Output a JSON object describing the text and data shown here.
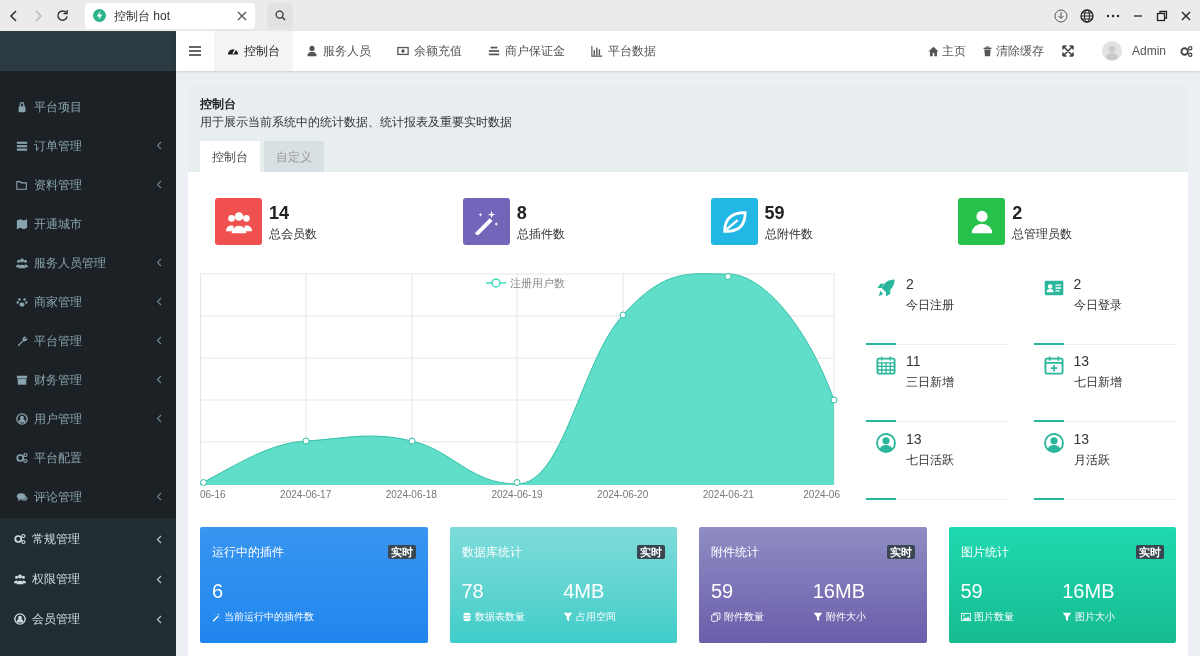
{
  "browser": {
    "tab_title": "控制台 hot"
  },
  "sidebar": {
    "items": [
      {
        "label": "平台项目",
        "kind": "plain"
      },
      {
        "label": "订单管理",
        "kind": "sub"
      },
      {
        "label": "资料管理",
        "kind": "sub"
      },
      {
        "label": "开通城市",
        "kind": "plain"
      },
      {
        "label": "服务人员管理",
        "kind": "sub"
      },
      {
        "label": "商家管理",
        "kind": "sub"
      },
      {
        "label": "平台管理",
        "kind": "sub"
      },
      {
        "label": "财务管理",
        "kind": "sub"
      },
      {
        "label": "用户管理",
        "kind": "sub"
      },
      {
        "label": "平台配置",
        "kind": "plain"
      },
      {
        "label": "评论管理",
        "kind": "sub"
      }
    ],
    "groups": [
      {
        "label": "常规管理"
      },
      {
        "label": "权限管理"
      },
      {
        "label": "会员管理"
      }
    ]
  },
  "topnav": {
    "tabs": [
      {
        "label": "控制台",
        "selected": true
      },
      {
        "label": "服务人员",
        "selected": false
      },
      {
        "label": "余额充值",
        "selected": false
      },
      {
        "label": "商户保证金",
        "selected": false
      },
      {
        "label": "平台数据",
        "selected": false
      }
    ],
    "right": [
      {
        "label": "主页"
      },
      {
        "label": "清除缓存"
      }
    ],
    "user": "Admin"
  },
  "panel": {
    "title": "控制台",
    "subtitle": "用于展示当前系统中的统计数据、统计报表及重要实时数据",
    "tabs": [
      {
        "label": "控制台",
        "selected": true
      },
      {
        "label": "自定义",
        "selected": false
      }
    ]
  },
  "summary": [
    {
      "value": "14",
      "label": "总会员数",
      "color": "#f05050"
    },
    {
      "value": "8",
      "label": "总插件数",
      "color": "#7266ba"
    },
    {
      "value": "59",
      "label": "总附件数",
      "color": "#23b7e5"
    },
    {
      "value": "2",
      "label": "总管理员数",
      "color": "#27c24c"
    }
  ],
  "chart": {
    "legend": "注册用户数",
    "x_labels": [
      "06-16",
      "2024-06-17",
      "2024-06-18",
      "2024-06-19",
      "2024-06-20",
      "2024-06-21",
      "2024-06"
    ]
  },
  "stats": [
    {
      "value": "2",
      "label": "今日注册"
    },
    {
      "value": "2",
      "label": "今日登录"
    },
    {
      "value": "11",
      "label": "三日新增"
    },
    {
      "value": "13",
      "label": "七日新增"
    },
    {
      "value": "13",
      "label": "七日活跃"
    },
    {
      "value": "13",
      "label": "月活跃"
    }
  ],
  "cards": [
    {
      "title": "运行中的插件",
      "badge": "实时",
      "items": [
        {
          "value": "6",
          "label": "当前运行中的插件数"
        }
      ]
    },
    {
      "title": "数据库统计",
      "badge": "实时",
      "items": [
        {
          "value": "78",
          "label": "数据表数量"
        },
        {
          "value": "4MB",
          "label": "占用空间"
        }
      ]
    },
    {
      "title": "附件统计",
      "badge": "实时",
      "items": [
        {
          "value": "59",
          "label": "附件数量"
        },
        {
          "value": "16MB",
          "label": "附件大小"
        }
      ]
    },
    {
      "title": "图片统计",
      "badge": "实时",
      "items": [
        {
          "value": "59",
          "label": "图片数量"
        },
        {
          "value": "16MB",
          "label": "图片大小"
        }
      ]
    }
  ]
}
